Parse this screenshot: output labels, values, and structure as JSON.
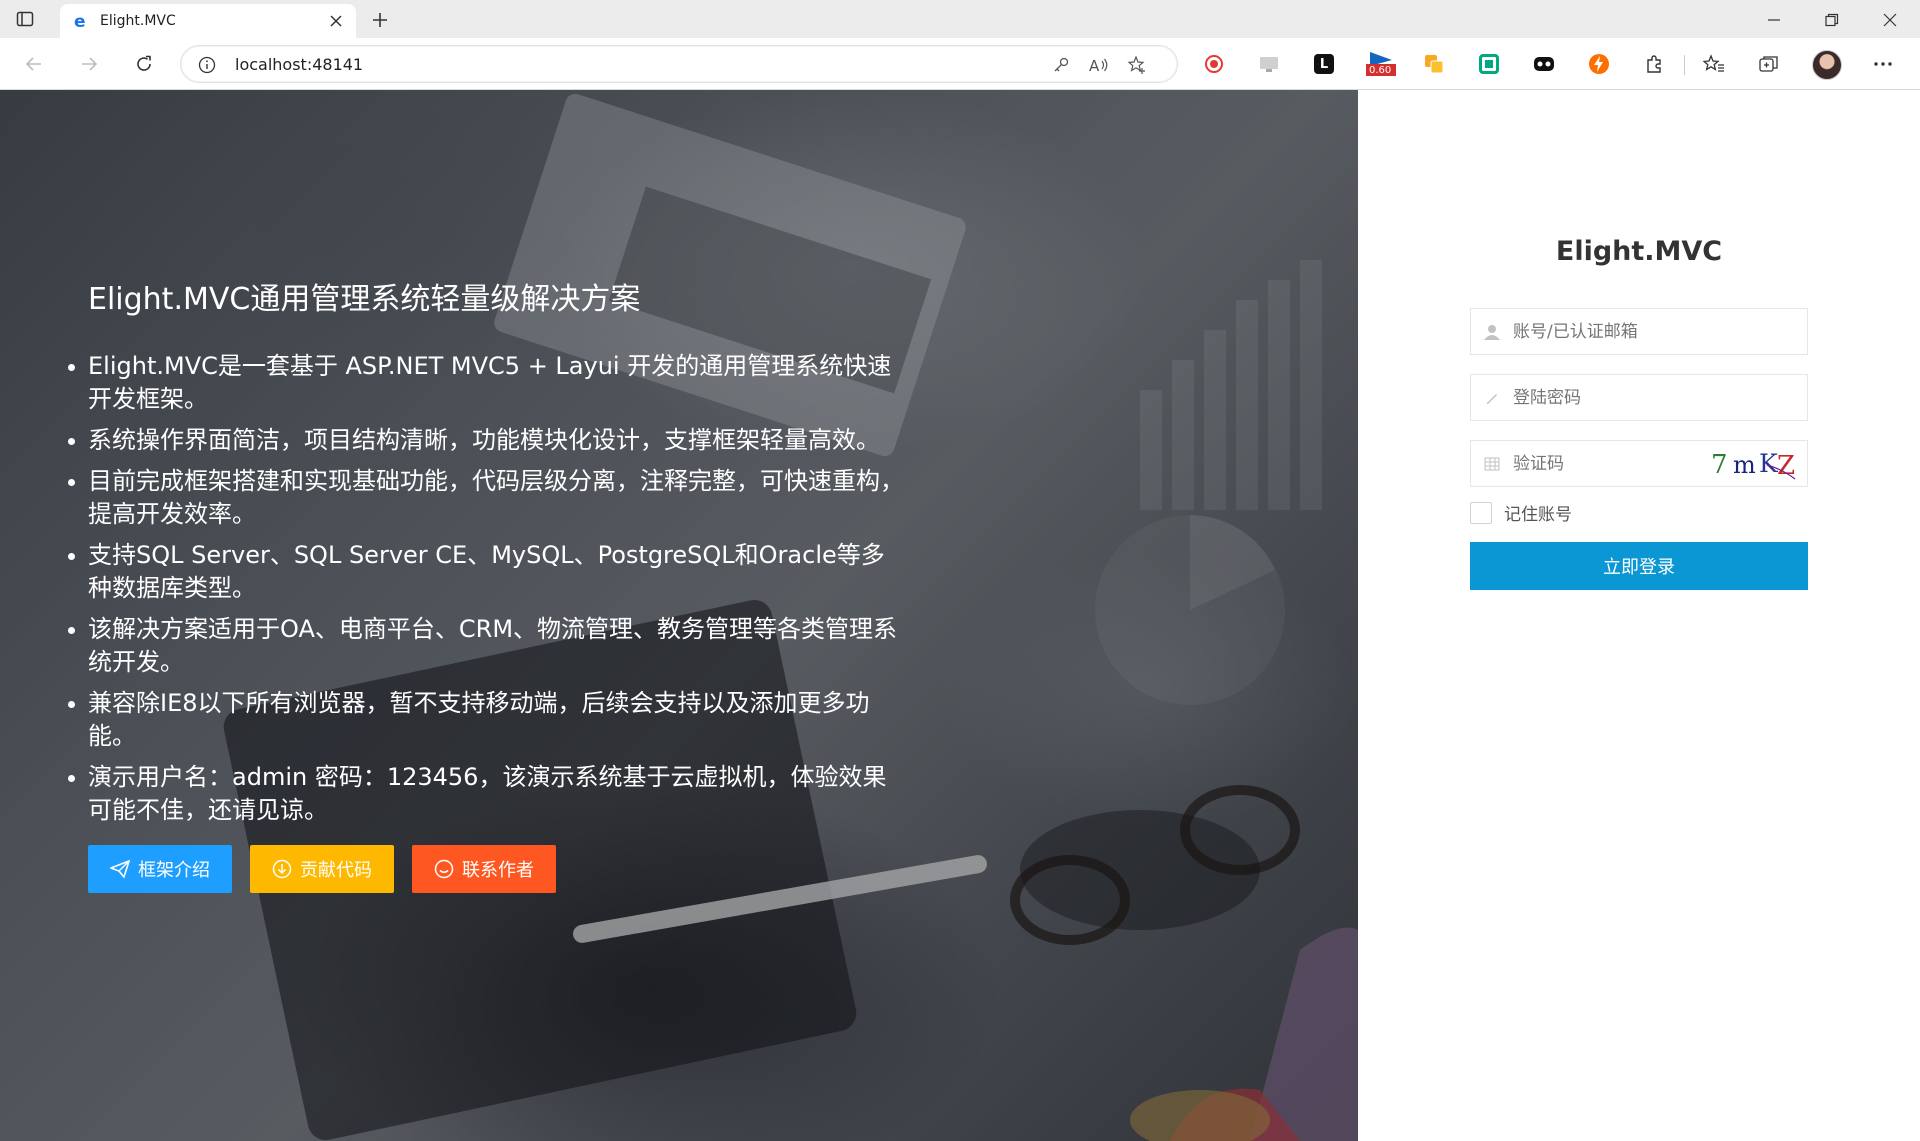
{
  "browser": {
    "tab_title": "Elight.MVC",
    "url": "localhost:48141",
    "extension_badge": "0.60"
  },
  "hero": {
    "title": "Elight.MVC通用管理系统轻量级解决方案",
    "items": [
      "Elight.MVC是一套基于 ASP.NET MVC5 + Layui 开发的通用管理系统快速开发框架。",
      "系统操作界面简洁，项目结构清晰，功能模块化设计，支撑框架轻量高效。",
      "目前完成框架搭建和实现基础功能，代码层级分离，注释完整，可快速重构，提高开发效率。",
      "支持SQL Server、SQL Server CE、MySQL、PostgreSQL和Oracle等多种数据库类型。",
      "该解决方案适用于OA、电商平台、CRM、物流管理、教务管理等各类管理系统开发。",
      "兼容除IE8以下所有浏览器，暂不支持移动端，后续会支持以及添加更多功能。",
      "演示用户名：admin 密码：123456，该演示系统基于云虚拟机，体验效果可能不佳，还请见谅。"
    ],
    "buttons": {
      "intro": "框架介绍",
      "contribute": "贡献代码",
      "contact": "联系作者"
    },
    "button_colors": {
      "intro": "#1e9fff",
      "contribute": "#ffb800",
      "contact": "#ff5722"
    }
  },
  "login": {
    "title": "Elight.MVC",
    "account_placeholder": "账号/已认证邮箱",
    "password_placeholder": "登陆密码",
    "captcha_placeholder": "验证码",
    "captcha_text": "7mKZ",
    "remember_label": "记住账号",
    "submit_label": "立即登录",
    "submit_color": "#0a97d3"
  }
}
